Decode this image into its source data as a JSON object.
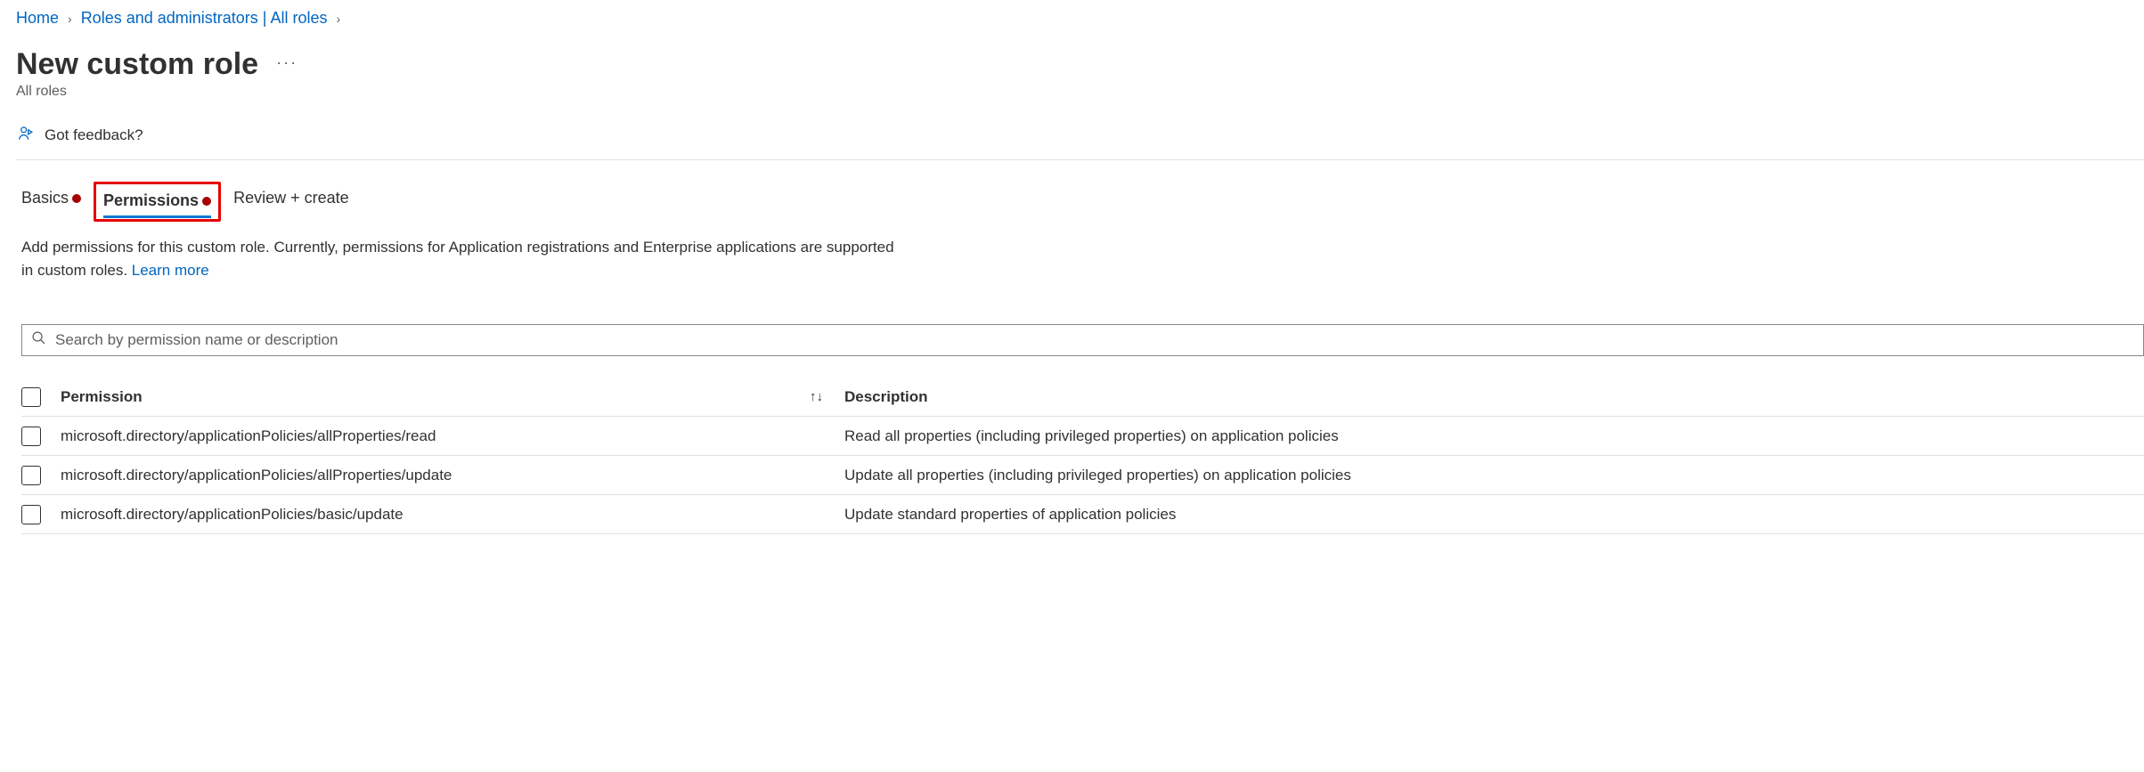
{
  "breadcrumb": {
    "home": "Home",
    "roles": "Roles and administrators | All roles"
  },
  "page": {
    "title": "New custom role",
    "subtitle": "All roles",
    "ellipsis": "···"
  },
  "feedback": {
    "label": "Got feedback?"
  },
  "tabs": {
    "basics": "Basics",
    "permissions": "Permissions",
    "review": "Review + create"
  },
  "description": {
    "line1": "Add permissions for this custom role. Currently, permissions for Application registrations and Enterprise applications are supported",
    "line2": "in custom roles. ",
    "learnMore": "Learn more"
  },
  "search": {
    "placeholder": "Search by permission name or description"
  },
  "table": {
    "headers": {
      "permission": "Permission",
      "description": "Description",
      "sortGlyph": "↑↓"
    },
    "rows": [
      {
        "permission": "microsoft.directory/applicationPolicies/allProperties/read",
        "description": "Read all properties (including privileged properties) on application policies"
      },
      {
        "permission": "microsoft.directory/applicationPolicies/allProperties/update",
        "description": "Update all properties (including privileged properties) on application policies"
      },
      {
        "permission": "microsoft.directory/applicationPolicies/basic/update",
        "description": "Update standard properties of application policies"
      }
    ]
  }
}
